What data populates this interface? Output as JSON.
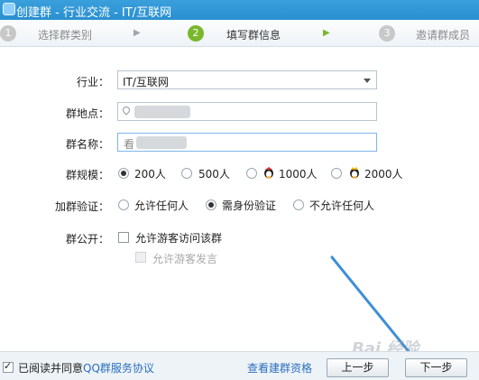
{
  "window": {
    "title": "创建群 - 行业交流 - IT/互联网"
  },
  "steps": [
    {
      "num": "1",
      "label": "选择群类别"
    },
    {
      "num": "2",
      "label": "填写群信息"
    },
    {
      "num": "3",
      "label": "邀请群成员"
    }
  ],
  "form": {
    "industry": {
      "label": "行业：",
      "value": "IT/互联网"
    },
    "location": {
      "label": "群地点："
    },
    "name": {
      "label": "群名称：",
      "value_prefix": "看"
    },
    "scale": {
      "label": "群规模：",
      "options": [
        "200人",
        "500人",
        "1000人",
        "2000人"
      ],
      "selected": 0
    },
    "verify": {
      "label": "加群验证：",
      "options": [
        "允许任何人",
        "需身份验证",
        "不允许任何人"
      ],
      "selected": 1
    },
    "public": {
      "label": "群公开：",
      "visitor_access": "允许游客访问该群",
      "visitor_post": "允许游客发言"
    }
  },
  "footer": {
    "agree_text": "已阅读并同意",
    "agree_link": "QQ群服务协议",
    "qualify_link": "查看建群资格",
    "prev_button": "上一步",
    "next_button": "下一步"
  },
  "watermark": "Bai 经验"
}
